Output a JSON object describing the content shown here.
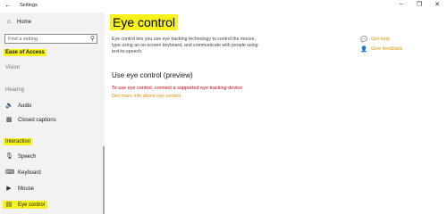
{
  "window": {
    "title": "Settings",
    "back_icon": "back-arrow-icon",
    "controls": [
      "minimize-icon",
      "restore-icon",
      "close-icon"
    ]
  },
  "sidebar": {
    "home": {
      "label": "Home",
      "icon": "home-icon"
    },
    "search": {
      "placeholder": "Find a setting",
      "icon": "search-icon"
    },
    "category": "Ease of Access",
    "sections": {
      "vision": "Vision",
      "hearing": "Hearing",
      "interaction": "Interaction"
    },
    "hearing_items": [
      {
        "label": "Audio",
        "icon": "speaker-icon"
      },
      {
        "label": "Closed captions",
        "icon": "captions-icon"
      }
    ],
    "interaction_items": [
      {
        "label": "Speech",
        "icon": "microphone-icon"
      },
      {
        "label": "Keyboard",
        "icon": "keyboard-icon"
      },
      {
        "label": "Mouse",
        "icon": "mouse-icon"
      },
      {
        "label": "Eye control",
        "icon": "eye-control-icon",
        "selected": true
      }
    ],
    "highlight_color": "#f7f21a"
  },
  "main": {
    "title": "Eye control",
    "description": "Eye control lets you use eye tracking technology to control the mouse, type using an on-screen keyboard, and communicate with people using text-to-speech.",
    "subheading": "Use eye control (preview)",
    "warning": "To use eye control, connect a supported eye tracking device",
    "more_info_link": "Get more info about eye control",
    "side_links": [
      {
        "label": "Get help",
        "icon": "help-chat-icon"
      },
      {
        "label": "Give feedback",
        "icon": "feedback-icon"
      }
    ],
    "warning_color": "#d40000",
    "link_color": "#e09400"
  }
}
